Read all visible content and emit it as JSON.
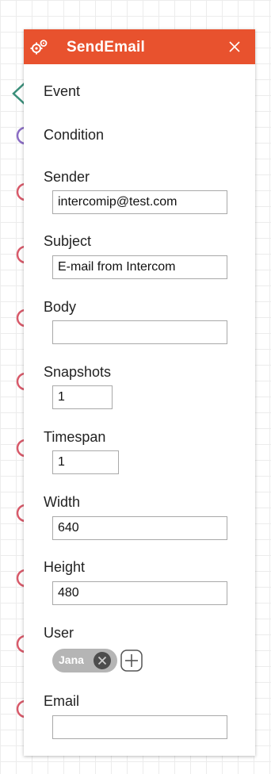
{
  "node": {
    "title": "SendEmail",
    "header_color": "#e8522e",
    "header_icon": "gears-icon",
    "close_icon": "close-icon"
  },
  "ports": [
    {
      "label": "Event",
      "shape": "diamond",
      "color": "#3a8f7a"
    },
    {
      "label": "Condition",
      "shape": "circle",
      "color": "#8a6cc4"
    },
    {
      "label": "Sender",
      "shape": "circle",
      "color": "#d85a6a",
      "value": "intercomip@test.com"
    },
    {
      "label": "Subject",
      "shape": "circle",
      "color": "#d85a6a",
      "value": "E-mail from Intercom"
    },
    {
      "label": "Body",
      "shape": "circle",
      "color": "#d85a6a",
      "value": ""
    },
    {
      "label": "Snapshots",
      "shape": "circle",
      "color": "#d85a6a",
      "value": "1"
    },
    {
      "label": "Timespan",
      "shape": "circle",
      "color": "#d85a6a",
      "value": "1"
    },
    {
      "label": "Width",
      "shape": "circle",
      "color": "#d85a6a",
      "value": "640"
    },
    {
      "label": "Height",
      "shape": "circle",
      "color": "#d85a6a",
      "value": "480"
    },
    {
      "label": "User",
      "shape": "circle",
      "color": "#d85a6a"
    },
    {
      "label": "Email",
      "shape": "circle",
      "color": "#d85a6a",
      "value": ""
    }
  ],
  "user_chip": {
    "text": "Jana",
    "remove_icon": "close-circle-icon",
    "add_icon": "plus-icon"
  }
}
